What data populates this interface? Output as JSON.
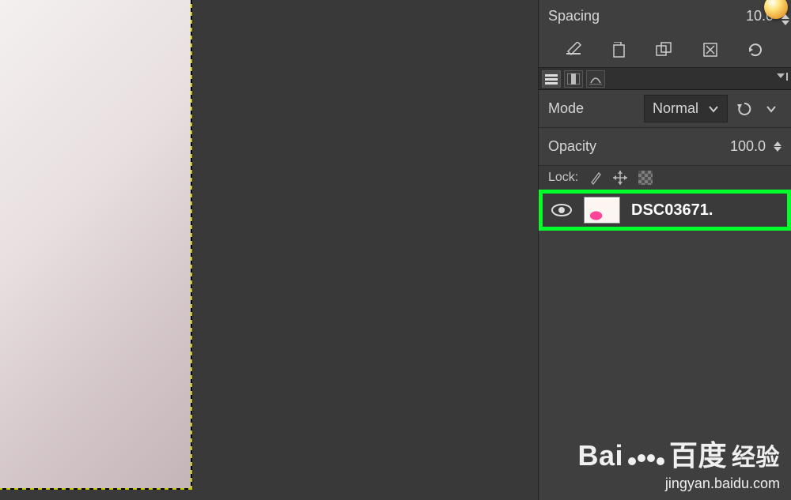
{
  "spacing": {
    "label": "Spacing",
    "value": "10.0"
  },
  "mode": {
    "label": "Mode",
    "selected": "Normal"
  },
  "opacity": {
    "label": "Opacity",
    "value": "100.0"
  },
  "lock": {
    "label": "Lock:"
  },
  "layers": [
    {
      "name": "DSC03671.",
      "visible": true
    }
  ],
  "watermark": {
    "brand_en": "Bai",
    "brand_du": "百度",
    "cn": "经验",
    "sub": "jingyan.baidu.com"
  }
}
